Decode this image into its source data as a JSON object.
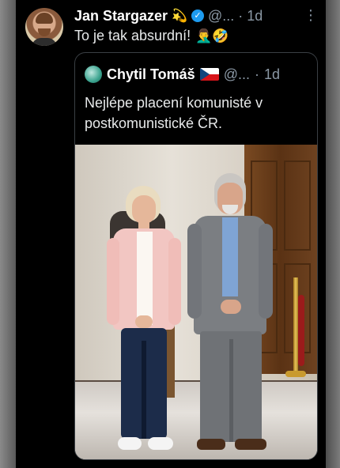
{
  "tweet": {
    "author_name": "Jan Stargazer",
    "author_emoji": "💫",
    "handle": "@...",
    "separator": "·",
    "time": "1d",
    "text": "To je tak absurdní!",
    "emojis": "🤦‍♂️🤣",
    "more_icon": "more-vertical-icon"
  },
  "quoted": {
    "author_name": "Chytil Tomáš",
    "flag": "czech-flag-icon",
    "handle": "@...",
    "separator": "·",
    "time": "1d",
    "text": "Nejlépe placení komunisté v postkomunistické ČR."
  },
  "colors": {
    "background": "#000000",
    "text": "#e7e9ea",
    "muted": "#8b98a5",
    "verified": "#1d9bf0",
    "border": "#3a3f44"
  }
}
